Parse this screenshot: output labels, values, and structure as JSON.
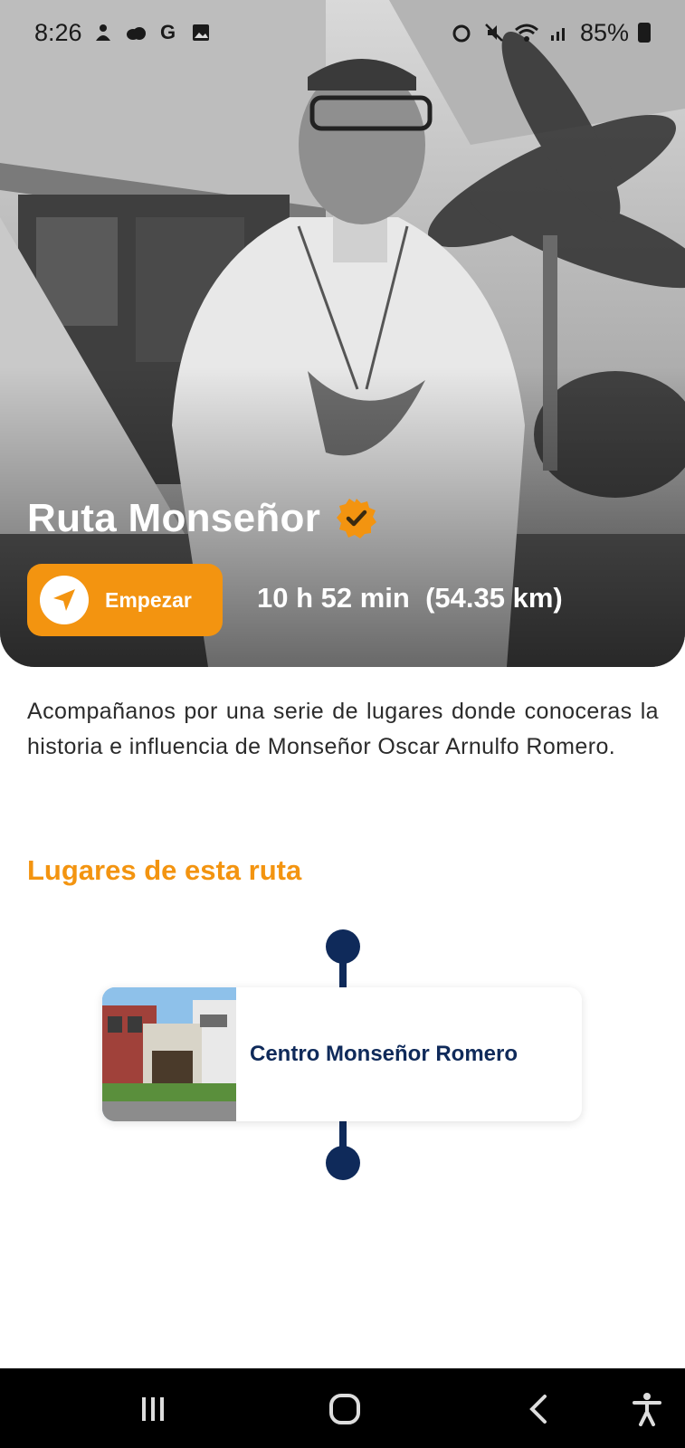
{
  "status_bar": {
    "time": "8:26",
    "battery": "85%",
    "left_icons": [
      "notification-icon",
      "cloud-icon",
      "google-icon",
      "image-icon"
    ],
    "right_icons": [
      "alarm-icon",
      "mute-icon",
      "wifi-icon",
      "signal-icon",
      "battery-icon"
    ]
  },
  "hero": {
    "title": "Ruta Monseñor",
    "start_label": "Empezar",
    "route_meta": "10 h 52 min  (54.35 km)"
  },
  "description": "Acompañanos por una serie de lugares donde conoceras la historia e influencia de Monseñor Oscar Arnulfo Romero.",
  "places_section": {
    "title": "Lugares de esta ruta",
    "places": [
      {
        "name": "Centro Monseñor Romero"
      }
    ]
  },
  "colors": {
    "accent": "#f39410",
    "navy": "#0f2a5a",
    "text": "#2b2b2b"
  },
  "nav_bar": {
    "buttons": [
      "recent-apps-icon",
      "home-icon",
      "back-icon",
      "accessibility-icon"
    ]
  }
}
